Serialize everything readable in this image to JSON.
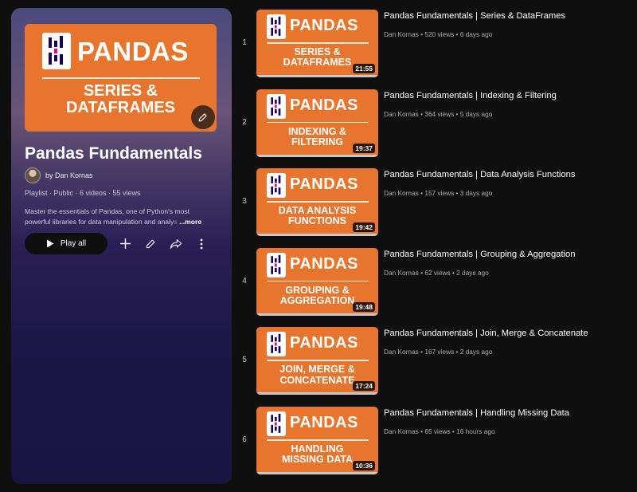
{
  "playlist": {
    "thumb_word": "PANDAS",
    "thumb_subtitle_line1": "SERIES &",
    "thumb_subtitle_line2": "DATAFRAMES",
    "title": "Pandas Fundamentals",
    "owner": "by Dan Kornas",
    "meta": "Playlist · Public · 6 videos · 55 views",
    "description_line1": "Master the essentials of Pandas, one of Python's most",
    "description_line2": "powerful libraries for data manipulation and analy",
    "description_fade": "s",
    "more_label": "...more",
    "play_all_label": "Play all"
  },
  "videos": [
    {
      "index": "1",
      "word": "PANDAS",
      "sub1": "SERIES &",
      "sub2": "DATAFRAMES",
      "duration": "21:55",
      "title": "Pandas Fundamentals | Series & DataFrames",
      "meta": "Dan Kornas • 520 views • 6 days ago"
    },
    {
      "index": "2",
      "word": "PANDAS",
      "sub1": "INDEXING &",
      "sub2": "FILTERING",
      "duration": "19:37",
      "title": "Pandas Fundamentals | Indexing & Filtering",
      "meta": "Dan Kornas • 364 views • 5 days ago"
    },
    {
      "index": "3",
      "word": "PANDAS",
      "sub1": "DATA ANALYSIS",
      "sub2": "FUNCTIONS",
      "duration": "19:42",
      "title": "Pandas Fundamentals | Data Analysis Functions",
      "meta": "Dan Kornas • 157 views • 3 days ago"
    },
    {
      "index": "4",
      "word": "PANDAS",
      "sub1": "GROUPING &",
      "sub2": "AGGREGATION",
      "duration": "19:48",
      "title": "Pandas Fundamentals | Grouping & Aggregation",
      "meta": "Dan Kornas • 62 views • 2 days ago"
    },
    {
      "index": "5",
      "word": "PANDAS",
      "sub1": "JOIN, MERGE &",
      "sub2": "CONCATENATE",
      "duration": "17:24",
      "title": "Pandas Fundamentals | Join, Merge & Concatenate",
      "meta": "Dan Kornas • 167 views • 2 days ago"
    },
    {
      "index": "6",
      "word": "PANDAS",
      "sub1": "HANDLING",
      "sub2": "MISSING DATA",
      "duration": "10:36",
      "title": "Pandas Fundamentals | Handling Missing Data",
      "meta": "Dan Kornas • 65 views • 16 hours ago"
    }
  ],
  "icons": {
    "play": "play-icon",
    "add": "plus-icon",
    "edit": "pencil-icon",
    "share": "share-icon",
    "more": "more-vert-icon"
  },
  "colors": {
    "thumb_orange": "#e8752d",
    "pandas_mark": "#150458",
    "pandas_accent": "#e70488"
  }
}
